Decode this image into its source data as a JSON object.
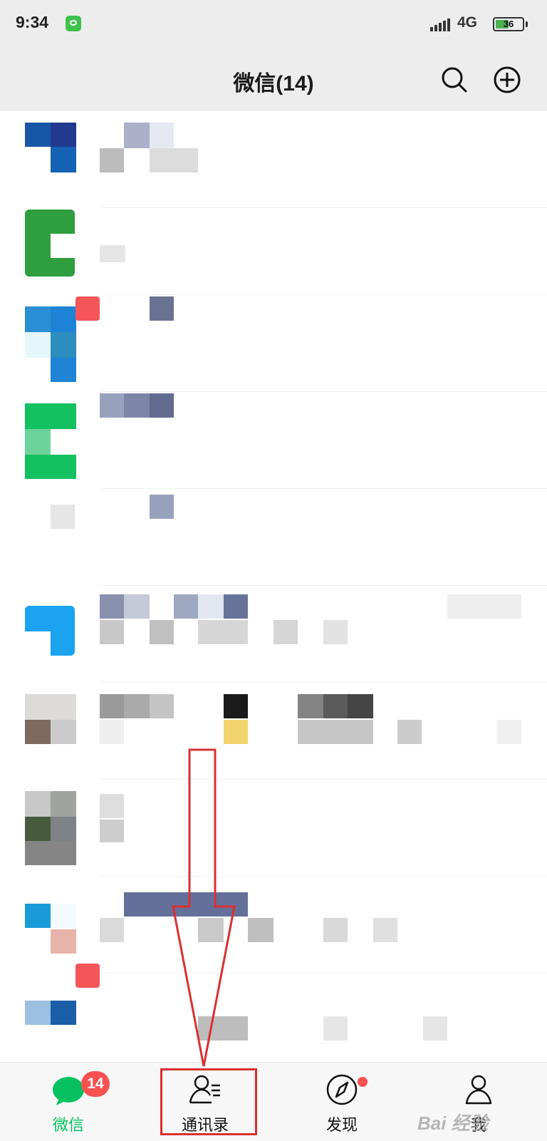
{
  "status_bar": {
    "time": "9:34",
    "network": "4G",
    "battery_level": "36"
  },
  "header": {
    "title": "微信(14)"
  },
  "tabs": [
    {
      "label": "微信",
      "badge": "14",
      "icon": "chat-bubble-icon",
      "active": true
    },
    {
      "label": "通讯录",
      "icon": "contacts-icon",
      "active": false
    },
    {
      "label": "发现",
      "icon": "compass-icon",
      "active": false,
      "red_dot": true
    },
    {
      "label": "我",
      "icon": "person-icon",
      "active": false
    }
  ],
  "watermark": "Bai 经验",
  "colors": {
    "accent_green": "#07c160",
    "badge_red": "#fa5151",
    "annotation_red": "#d93030",
    "header_bg": "#ededed"
  }
}
